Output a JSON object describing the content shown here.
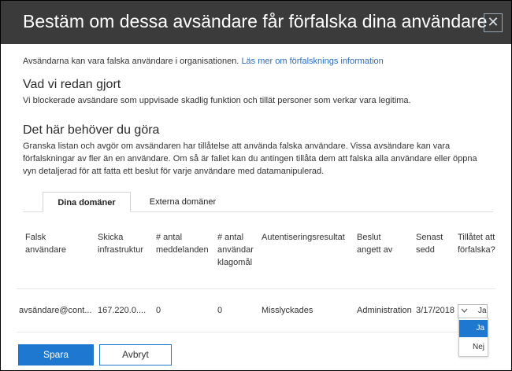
{
  "header": {
    "title": "Bestäm om dessa avsändare får förfalska dina användare",
    "close_glyph": "✕"
  },
  "intro": {
    "text": "Avsändarna kan vara falska användare i organisationen.",
    "link": "Läs mer om förfalsknings information"
  },
  "done": {
    "title": "Vad vi redan gjort",
    "text": "Vi blockerade avsändare som uppvisade skadlig funktion och tillät personer som verkar vara legitima."
  },
  "todo": {
    "title": "Det här behöver du göra",
    "text": "Granska listan och avgör om avsändaren har tillåtelse att använda falska användare. Vissa avsändare kan vara förfalskningar av fler än en användare. Om så är fallet kan du antingen tillåta dem att falska alla användare eller öppna vyn detaljerad för att fatta ett beslut för varje användare med datamanipulerad."
  },
  "tabs": [
    {
      "label": "Dina domäner",
      "active": true
    },
    {
      "label": "Externa domäner",
      "active": false
    }
  ],
  "table": {
    "headers": [
      "Falsk användare",
      "Skicka infrastruktur",
      "# antal meddelanden",
      "# antal användar klagomål",
      "Autentiseringsresultat",
      "Beslut angett av",
      "Senast sedd",
      "Tillåtet att förfalska?"
    ],
    "rows": [
      {
        "spoofed_user": "avsändare@cont...",
        "infrastructure": "167.220.0....",
        "messages": "0",
        "complaints": "0",
        "auth_result": "Misslyckades",
        "decision_by": "Administration",
        "last_seen": "3/17/2018",
        "allowed": "Ja"
      }
    ]
  },
  "dropdown": {
    "options": [
      "Ja",
      "Nej"
    ],
    "selected": "Ja"
  },
  "buttons": {
    "save": "Spara",
    "cancel": "Avbryt"
  },
  "colors": {
    "header_bg": "#3b3b3b",
    "accent": "#1e78d0",
    "link": "#2a6cbf"
  }
}
